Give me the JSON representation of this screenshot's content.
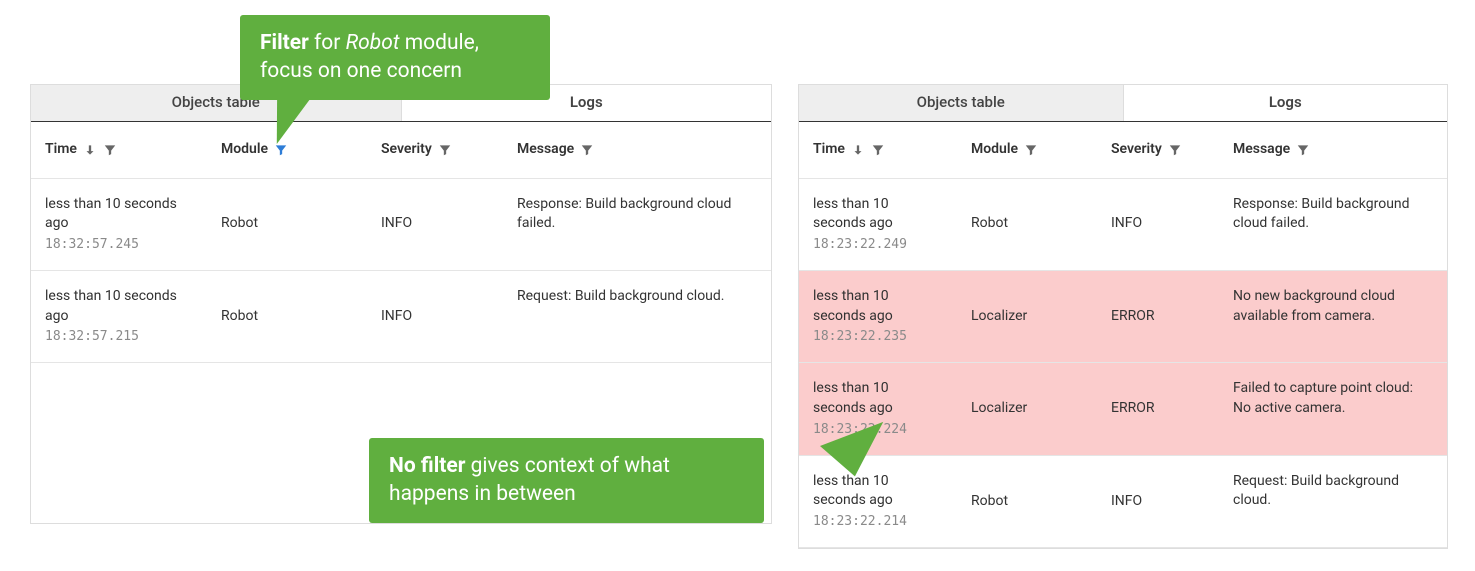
{
  "colors": {
    "accent_green": "#60af3f",
    "error_row_bg": "#fbcccc",
    "active_filter": "#2e7dd7"
  },
  "callouts": {
    "c1_bold": "Filter",
    "c1_mid": " for ",
    "c1_italic": "Robot",
    "c1_tail": " module, focus on one concern",
    "c2_bold": "No filter",
    "c2_tail": " gives context of what happens in between"
  },
  "tabs": {
    "objects": "Objects table",
    "logs": "Logs"
  },
  "headers": {
    "time": "Time",
    "module": "Module",
    "severity": "Severity",
    "message": "Message"
  },
  "left_rows": [
    {
      "rel": "less than 10 seconds ago",
      "abs": "18:32:57.245",
      "module": "Robot",
      "severity": "INFO",
      "msg": "Response: Build background cloud failed."
    },
    {
      "rel": "less than 10 seconds ago",
      "abs": "18:32:57.215",
      "module": "Robot",
      "severity": "INFO",
      "msg": "Request: Build background cloud."
    }
  ],
  "right_rows": [
    {
      "rel": "less than 10 seconds ago",
      "abs": "18:23:22.249",
      "module": "Robot",
      "severity": "INFO",
      "msg": "Response: Build background cloud failed.",
      "error": false
    },
    {
      "rel": "less than 10 seconds ago",
      "abs": "18:23:22.235",
      "module": "Localizer",
      "severity": "ERROR",
      "msg": "No new background cloud available from camera.",
      "error": true
    },
    {
      "rel": "less than 10 seconds ago",
      "abs": "18:23:22.224",
      "module": "Localizer",
      "severity": "ERROR",
      "msg": "Failed to capture point cloud: No active camera.",
      "error": true
    },
    {
      "rel": "less than 10 seconds ago",
      "abs": "18:23:22.214",
      "module": "Robot",
      "severity": "INFO",
      "msg": "Request: Build background cloud.",
      "error": false
    }
  ]
}
